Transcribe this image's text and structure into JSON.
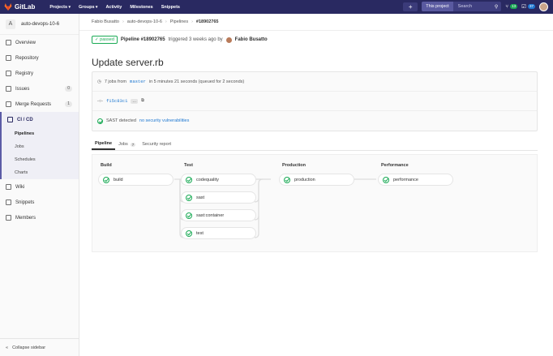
{
  "topbar": {
    "brand": "GitLab",
    "nav": [
      "Projects",
      "Groups",
      "Activity",
      "Milestones",
      "Snippets"
    ],
    "scope": "This project",
    "search_placeholder": "Search",
    "issues_count": "13",
    "todos_count": "37"
  },
  "sidebar": {
    "project_initial": "A",
    "project_name": "auto-devops-10-6",
    "items": [
      {
        "label": "Overview"
      },
      {
        "label": "Repository"
      },
      {
        "label": "Registry"
      },
      {
        "label": "Issues",
        "count": "0"
      },
      {
        "label": "Merge Requests",
        "count": "1"
      }
    ],
    "cicd": "CI / CD",
    "cicd_sub": [
      "Pipelines",
      "Jobs",
      "Schedules",
      "Charts"
    ],
    "items_after": [
      {
        "label": "Wiki"
      },
      {
        "label": "Snippets"
      },
      {
        "label": "Members"
      }
    ],
    "collapse": "Collapse sidebar"
  },
  "breadcrumb": [
    "Fabio Busatto",
    "auto-devops-10-6",
    "Pipelines",
    "#18902765"
  ],
  "pipeline": {
    "status": "passed",
    "id_text": "Pipeline #18902765",
    "triggered": "triggered 3 weeks ago by",
    "author": "Fabio Busatto",
    "title": "Update server.rb",
    "jobs_prefix": "7 jobs from",
    "branch": "master",
    "jobs_suffix": "in 5 minutes 21 seconds (queued for 2 seconds)",
    "commit": "f15c83c1",
    "commit_more": "...",
    "sast_prefix": "SAST detected",
    "sast_link": "no security vulnerabilities"
  },
  "tabs": [
    {
      "label": "Pipeline"
    },
    {
      "label": "Jobs",
      "count": "7"
    },
    {
      "label": "Security report"
    }
  ],
  "stages": [
    {
      "name": "Build",
      "jobs": [
        "build"
      ]
    },
    {
      "name": "Test",
      "jobs": [
        "codequality",
        "sast",
        "sast:container",
        "test"
      ]
    },
    {
      "name": "Production",
      "jobs": [
        "production"
      ]
    },
    {
      "name": "Performance",
      "jobs": [
        "performance"
      ]
    }
  ],
  "colors": {
    "topbar": "#292961",
    "success": "#1aaa55",
    "link": "#1f78d1"
  }
}
